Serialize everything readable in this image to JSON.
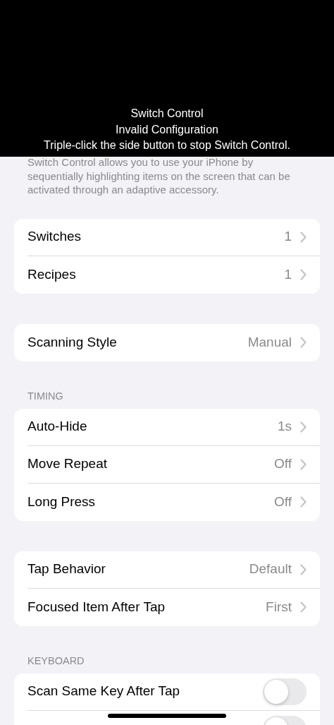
{
  "banner": {
    "lines": [
      "Switch Control",
      "Invalid Configuration",
      "Triple-click the side button to stop Switch Control."
    ]
  },
  "description": "Switch Control allows you to use your iPhone by sequentially highlighting items on the screen that can be activated through an adaptive accessory.",
  "sections": [
    {
      "rows": [
        {
          "kind": "link",
          "label": "Switches",
          "value": "1"
        },
        {
          "kind": "link",
          "label": "Recipes",
          "value": "1"
        }
      ]
    },
    {
      "rows": [
        {
          "kind": "link",
          "label": "Scanning Style",
          "value": "Manual"
        }
      ]
    },
    {
      "header": "TIMING",
      "rows": [
        {
          "kind": "link",
          "label": "Auto-Hide",
          "value": "1s"
        },
        {
          "kind": "link",
          "label": "Move Repeat",
          "value": "Off"
        },
        {
          "kind": "link",
          "label": "Long Press",
          "value": "Off"
        }
      ]
    },
    {
      "rows": [
        {
          "kind": "link",
          "label": "Tap Behavior",
          "value": "Default"
        },
        {
          "kind": "link",
          "label": "Focused Item After Tap",
          "value": "First"
        }
      ]
    },
    {
      "header": "KEYBOARD",
      "rows": [
        {
          "kind": "toggle",
          "label": "Scan Same Key After Tap",
          "on": false
        },
        {
          "kind": "toggle",
          "on": false
        }
      ]
    }
  ]
}
